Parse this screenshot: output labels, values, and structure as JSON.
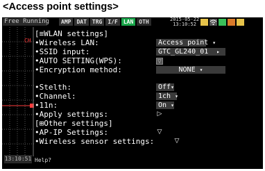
{
  "heading": "<Access point settings>",
  "topbar": {
    "mode": "Free Running",
    "tabs": [
      "AMP",
      "DAT",
      "TRG",
      "I/F",
      "LAN",
      "OTH"
    ],
    "active_tab": "LAN",
    "date": "2015-05-22",
    "time": "13:10:52"
  },
  "left": {
    "ch_label": "CH",
    "timestamp": "13:10:51"
  },
  "wlan": {
    "section_title": "[≡WLAN settings]",
    "wireless_lan_label": "•Wireless LAN:",
    "wireless_lan_value": "Access point",
    "ssid_label": "•SSID input:",
    "ssid_value": "GTC_GL240_01",
    "auto_setting_label": "•AUTO SETTING(WPS):",
    "encryption_label": "•Encryption method:",
    "encryption_value": "NONE",
    "stealth_label": "•Stelth:",
    "stealth_value": "Off",
    "channel_label": "•Channel:",
    "channel_value": "1ch",
    "n11_label": "•11n:",
    "n11_value": "On",
    "apply_label": "•Apply settings:"
  },
  "other": {
    "section_title": "[⊞Other settings]",
    "apip_label": "•AP-IP Settings:",
    "sensor_label": "•Wireless sensor settings:"
  },
  "help": {
    "text": "Help?"
  },
  "colors": {
    "active_tab": "#1aa64a",
    "value_bg": "#3a3a3a",
    "screen_bg": "#000000",
    "marker": "#ff3b3b"
  }
}
